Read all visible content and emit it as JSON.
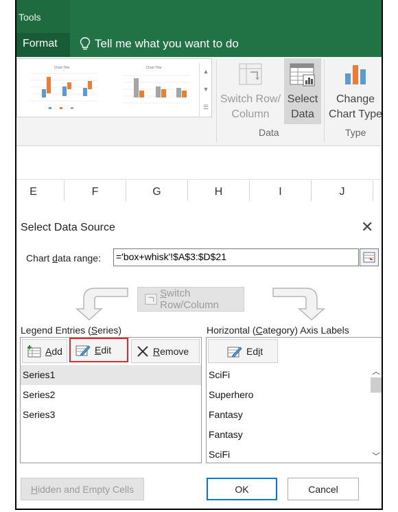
{
  "ribbon": {
    "tools_tab": "Tools",
    "format_tab": "Format",
    "tell_me": "Tell me what you want to do",
    "gallery": {
      "chart1_title": "Chart Title",
      "chart2_title": "Chart Title"
    },
    "switch_row_column": [
      "Switch Row/",
      "Column"
    ],
    "select_data": [
      "Select",
      "Data"
    ],
    "change_chart_type": [
      "Change",
      "Chart Type"
    ],
    "group_data": "Data",
    "group_type": "Type"
  },
  "sheet": {
    "columns": [
      "E",
      "F",
      "G",
      "H",
      "I",
      "J"
    ]
  },
  "dialog": {
    "title": "Select Data Source",
    "chart_range_label": "Chart data range:",
    "chart_range_value": "='box+whisk'!$A$3:$D$21",
    "switch_button": "Switch Row/Column",
    "legend_label": "Legend Entries (Series)",
    "add": "Add",
    "edit": "Edit",
    "remove": "Remove",
    "series": [
      "Series1",
      "Series2",
      "Series3"
    ],
    "axis_label": "Horizontal (Category) Axis Labels",
    "axis_edit": "Edit",
    "categories": [
      "SciFi",
      "Superhero",
      "Fantasy",
      "Fantasy",
      "SciFi"
    ],
    "hidden_cells": "Hidden and Empty Cells",
    "ok": "OK",
    "cancel": "Cancel"
  },
  "colors": {
    "excel_green": "#217346",
    "highlight_red": "#e02a2a",
    "focus_blue": "#0078d7"
  }
}
